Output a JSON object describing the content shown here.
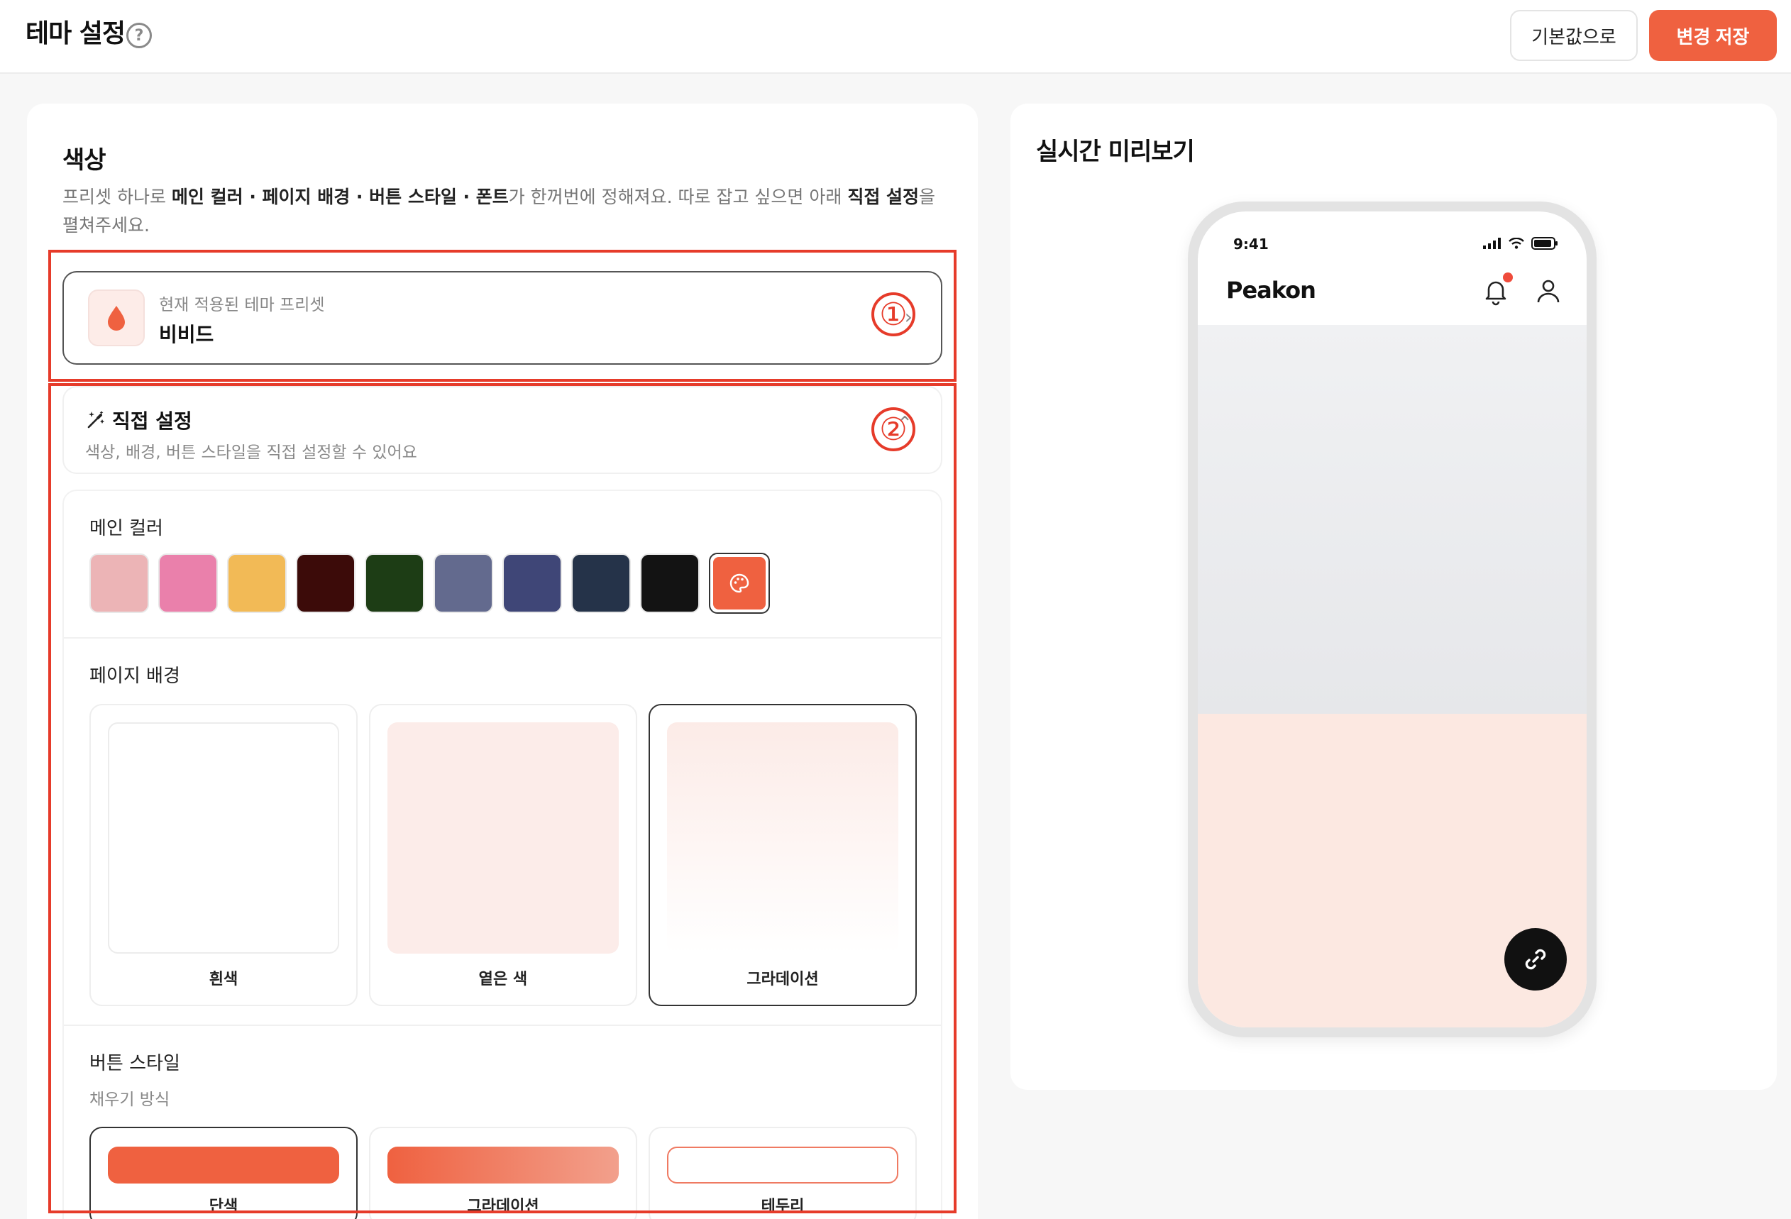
{
  "header": {
    "title": "테마 설정",
    "help_icon": "?",
    "default_button": "기본값으로",
    "save_button": "변경 저장"
  },
  "colors": {
    "accent": "#ef6140",
    "annotation": "#e63b2a"
  },
  "color_section": {
    "title": "색상",
    "desc_parts": [
      "프리셋 하나로 ",
      "메인 컬러 · 페이지 배경 · 버튼 스타일 · 폰트",
      "가 한꺼번에 정해져요. 따로 잡고 싶으면 아래 ",
      "직접 설정",
      "을 펼쳐주세요."
    ]
  },
  "annotations": [
    "①",
    "②"
  ],
  "preset": {
    "label": "현재 적용된 테마 프리셋",
    "name": "비비드",
    "icon": "drop-icon",
    "chevron": "›"
  },
  "direct": {
    "title": "직접 설정",
    "desc": "색상, 배경, 버튼 스타일을 직접 설정할 수 있어요",
    "icon": "magic-wand-icon",
    "chevron": "⌃"
  },
  "main_color": {
    "title": "메인 컬러",
    "swatches": [
      "#ecb4b6",
      "#ea80ab",
      "#f2ba56",
      "#3c0b09",
      "#1d3d15",
      "#636a8e",
      "#3f4677",
      "#253349",
      "#131313"
    ],
    "custom_icon": "palette-icon"
  },
  "page_bg": {
    "title": "페이지 배경",
    "options": [
      {
        "label": "흰색"
      },
      {
        "label": "옅은 색"
      },
      {
        "label": "그라데이션"
      }
    ]
  },
  "button_style": {
    "title": "버튼 스타일",
    "subtitle": "채우기 방식",
    "options": [
      {
        "label": "단색"
      },
      {
        "label": "그라데이션"
      },
      {
        "label": "테두리"
      }
    ]
  },
  "preview": {
    "title": "실시간 미리보기",
    "status_time": "9:41",
    "app_name": "Peakon"
  }
}
